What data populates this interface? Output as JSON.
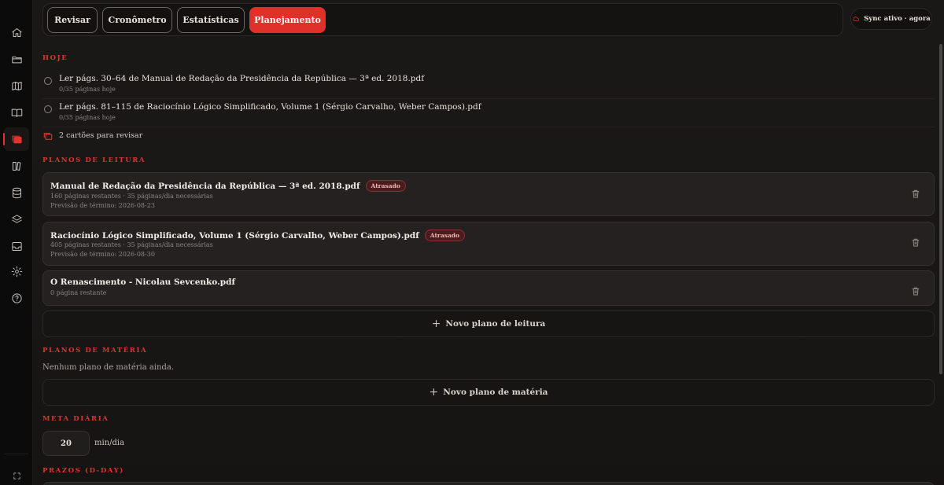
{
  "sidebar": {
    "items": [
      {
        "icon": "home-icon"
      },
      {
        "icon": "folder-icon"
      },
      {
        "icon": "map-icon"
      },
      {
        "icon": "book-open-icon"
      },
      {
        "icon": "cards-icon",
        "active": true
      },
      {
        "icon": "library-icon"
      },
      {
        "icon": "database-icon"
      },
      {
        "icon": "layers-icon"
      },
      {
        "icon": "inbox-icon"
      },
      {
        "icon": "settings-icon"
      },
      {
        "icon": "help-icon"
      }
    ],
    "footer_icon": "expand-icon"
  },
  "tabs": {
    "review": "Revisar",
    "timer": "Cronômetro",
    "stats": "Estatísticas",
    "planning": "Planejamento"
  },
  "sync": {
    "label": "Sync ativo · agora"
  },
  "today": {
    "title": "Hoje",
    "tasks": [
      {
        "title": "Ler págs. 30–64 de Manual de Redação da Presidência da República — 3ª ed. 2018.pdf",
        "progress": "0/35 páginas hoje"
      },
      {
        "title": "Ler págs. 81–115 de Raciocínio Lógico Simplificado, Volume 1 (Sérgio Carvalho, Weber Campos).pdf",
        "progress": "0/35 páginas hoje"
      }
    ],
    "cards_review": "2 cartões para revisar"
  },
  "reading_plans": {
    "title": "Planos de leitura",
    "items": [
      {
        "title": "Manual de Redação da Presidência da República — 3ª ed. 2018.pdf",
        "badge": "Atrasado",
        "line1": "160 páginas restantes · 35 páginas/dia necessárias",
        "line2": "Previsão de término: 2026-08-23"
      },
      {
        "title": "Raciocínio Lógico Simplificado, Volume 1 (Sérgio Carvalho, Weber Campos).pdf",
        "badge": "Atrasado",
        "line1": "405 páginas restantes · 35 páginas/dia necessárias",
        "line2": "Previsão de término: 2026-08-30"
      },
      {
        "title": "O Renascimento - Nicolau Sevcenko.pdf",
        "line1": "0 página restante"
      }
    ],
    "add_label": "Novo plano de leitura"
  },
  "subject_plans": {
    "title": "Planos de matéria",
    "empty": "Nenhum plano de matéria ainda.",
    "add_label": "Novo plano de matéria"
  },
  "daily_goal": {
    "title": "Meta diária",
    "value": "20",
    "unit": "min/dia"
  },
  "deadlines": {
    "title": "Prazos (D-Day)"
  },
  "colors": {
    "accent": "#e0302a",
    "background": "#1a1817",
    "card": "#242120"
  }
}
